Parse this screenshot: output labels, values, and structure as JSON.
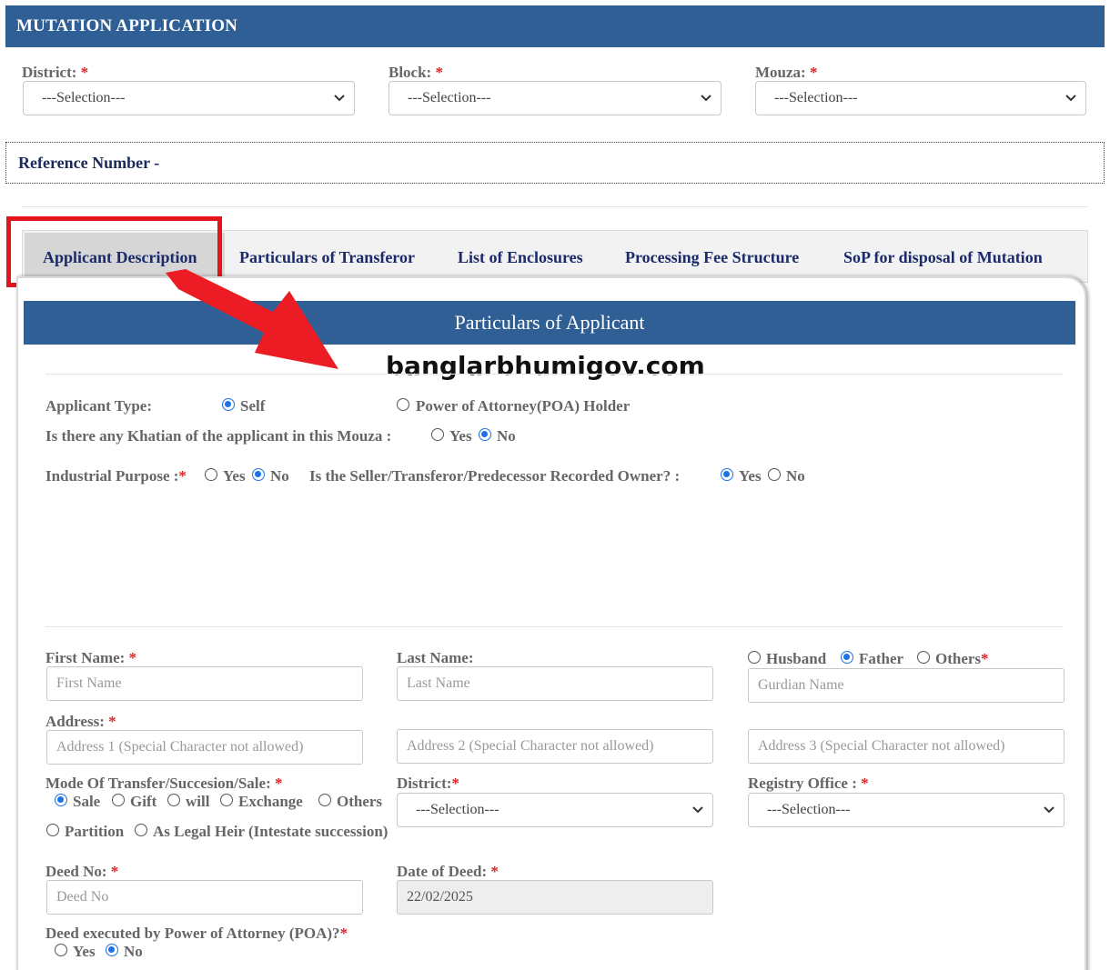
{
  "header": {
    "title": "MUTATION APPLICATION"
  },
  "top_filters": {
    "district_label": "District:",
    "block_label": "Block:",
    "mouza_label": "Mouza:",
    "required_mark": "*",
    "selection_text": "---Selection---"
  },
  "reference": {
    "label": "Reference Number -"
  },
  "tabs": [
    {
      "label": "Applicant Description",
      "active": true
    },
    {
      "label": "Particulars of Transferor"
    },
    {
      "label": "List of Enclosures"
    },
    {
      "label": "Processing Fee Structure"
    },
    {
      "label": "SoP for disposal of Mutation"
    }
  ],
  "panel": {
    "title": "Particulars of Applicant"
  },
  "watermark": "banglarbhumigov.com",
  "applicant_type": {
    "label": "Applicant Type:",
    "options": [
      "Self",
      "Power of Attorney(POA) Holder"
    ],
    "selected": "Self"
  },
  "khatian": {
    "label": "Is there any Khatian of the applicant in this Mouza :",
    "options": [
      "Yes",
      "No"
    ],
    "selected": "No"
  },
  "industrial": {
    "label": "Industrial Purpose :",
    "options": [
      "Yes",
      "No"
    ],
    "selected": "No"
  },
  "recorded_owner": {
    "label": "Is the Seller/Transferor/Predecessor Recorded Owner? :",
    "options": [
      "Yes",
      "No"
    ],
    "selected": "Yes"
  },
  "name": {
    "first_label": "First Name:",
    "first_placeholder": "First Name",
    "last_label": "Last Name:",
    "last_placeholder": "Last Name",
    "relation_options": [
      "Husband",
      "Father",
      "Others"
    ],
    "relation_selected": "Father",
    "guardian_placeholder": "Gurdian Name"
  },
  "address": {
    "label": "Address:",
    "placeholder1": "Address 1 (Special Character not allowed)",
    "placeholder2": "Address 2 (Special Character not allowed)",
    "placeholder3": "Address 3 (Special Character not allowed)"
  },
  "mode": {
    "label": "Mode Of Transfer/Succesion/Sale:",
    "options": [
      "Sale",
      "Gift",
      "will",
      "Exchange",
      "Others",
      "Partition",
      "As Legal Heir (Intestate succession)"
    ],
    "selected": "Sale"
  },
  "district2": {
    "label": "District:",
    "value": "---Selection---"
  },
  "registry": {
    "label": "Registry Office :",
    "value": "---Selection---"
  },
  "deed": {
    "no_label": "Deed No:",
    "no_placeholder": "Deed No",
    "date_label": "Date of Deed:",
    "date_value": "22/02/2025"
  },
  "poa": {
    "label": "Deed executed by Power of Attorney (POA)?",
    "options": [
      "Yes",
      "No"
    ],
    "selected": "No"
  },
  "colors": {
    "header_blue": "#2f5f94",
    "tab_text": "#1a2a6a",
    "required_red": "#d9262b",
    "highlight_red": "#e3141b",
    "radio_blue": "#1a73e8"
  }
}
